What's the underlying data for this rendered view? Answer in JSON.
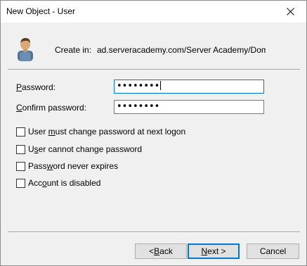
{
  "window": {
    "title": "New Object - User"
  },
  "header": {
    "icon": "user-icon",
    "create_in_label": "Create in:",
    "create_in_value": "ad.serveracademy.com/Server Academy/Domain U"
  },
  "password": {
    "label_prefix": "",
    "label_accel": "P",
    "label_rest": "assword:",
    "masked_value": "••••••••"
  },
  "confirm": {
    "label_prefix": "",
    "label_accel": "C",
    "label_rest": "onfirm password:",
    "masked_value": "••••••••"
  },
  "options": [
    {
      "pre": "User ",
      "accel": "m",
      "post": "ust change password at next logon",
      "checked": false
    },
    {
      "pre": "U",
      "accel": "s",
      "post": "er cannot change password",
      "checked": false
    },
    {
      "pre": "Pass",
      "accel": "w",
      "post": "ord never expires",
      "checked": false
    },
    {
      "pre": "Acc",
      "accel": "o",
      "post": "unt is disabled",
      "checked": false
    }
  ],
  "buttons": {
    "back_prefix": "< ",
    "back_accel": "B",
    "back_rest": "ack",
    "next_accel": "N",
    "next_rest": "ext >",
    "cancel": "Cancel"
  },
  "colors": {
    "focus_border": "#0078d7",
    "dialog_bg": "#f0f0f0"
  }
}
